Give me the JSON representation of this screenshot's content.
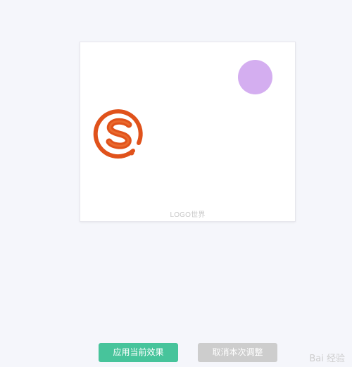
{
  "preview": {
    "logo_icon": "sogou-s-logo-icon",
    "logo_color": "#e0521b",
    "circle_color": "#d4aef0",
    "caption": "LOGO世界"
  },
  "actions": {
    "apply_label": "应用当前效果",
    "apply_color": "#47c49b",
    "cancel_label": "取消本次调整",
    "cancel_color": "#cdcdcd"
  },
  "watermark": {
    "text": "Bai 经验"
  }
}
